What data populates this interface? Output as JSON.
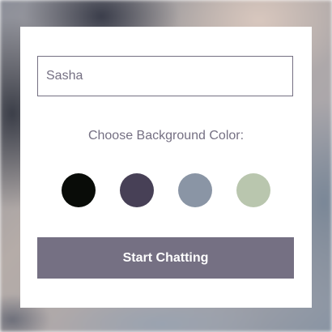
{
  "name_input": {
    "value": "Sasha"
  },
  "choose_color_label": "Choose Background Color:",
  "color_options": [
    {
      "name": "black",
      "color": "#090c08"
    },
    {
      "name": "purple",
      "color": "#474056"
    },
    {
      "name": "slate",
      "color": "#8a95a5"
    },
    {
      "name": "sage",
      "color": "#b9c6ae"
    }
  ],
  "start_button_label": "Start Chatting",
  "colors": {
    "accent": "#757083",
    "card_background": "#ffffff"
  }
}
